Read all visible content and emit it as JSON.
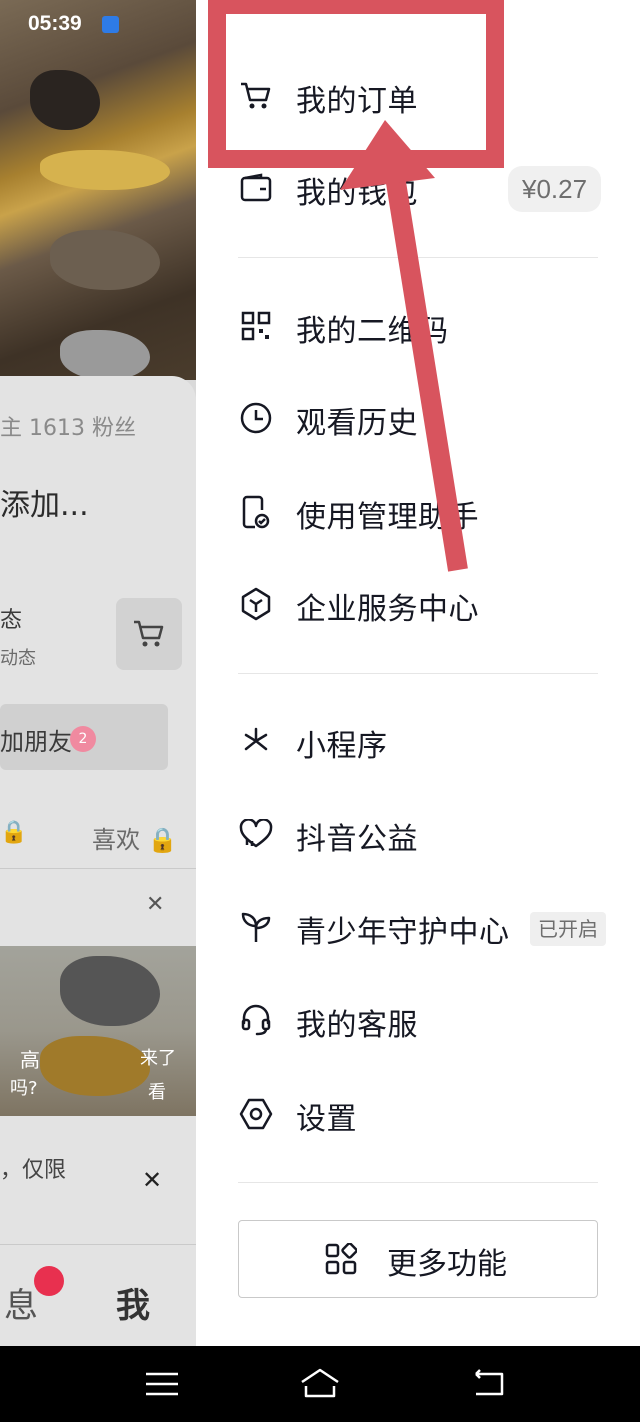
{
  "status_bar": {
    "time": "05:39"
  },
  "background": {
    "fans_text": "主  1613 粉丝",
    "add_text": "添加...",
    "state_title": "态",
    "state_subtitle": "动态",
    "friend_text": "加朋友",
    "friend_badge": "2",
    "lock_text": "🔒",
    "like_text": "喜欢 🔒",
    "video_text_1": "高",
    "video_text_2": "吗?",
    "video_text_3": "来了",
    "video_text_4": "看",
    "limited_text": "，仅限",
    "tab_message": "息",
    "tab_me": "我"
  },
  "drawer": {
    "group1": [
      {
        "label": "我的订单",
        "icon": "cart-icon"
      },
      {
        "label": "我的钱包",
        "icon": "wallet-icon",
        "badge": "¥0.27"
      }
    ],
    "group2": [
      {
        "label": "我的二维码",
        "icon": "qrcode-icon"
      },
      {
        "label": "观看历史",
        "icon": "clock-icon"
      },
      {
        "label": "使用管理助手",
        "icon": "phone-check-icon"
      },
      {
        "label": "企业服务中心",
        "icon": "enterprise-icon"
      }
    ],
    "group3": [
      {
        "label": "小程序",
        "icon": "miniprogram-icon"
      },
      {
        "label": "抖音公益",
        "icon": "heart-icon"
      },
      {
        "label": "青少年守护中心",
        "icon": "sprout-icon",
        "badge": "已开启"
      },
      {
        "label": "我的客服",
        "icon": "headset-icon"
      },
      {
        "label": "设置",
        "icon": "settings-icon"
      }
    ],
    "more_button": {
      "label": "更多功能",
      "icon": "grid-icon"
    }
  },
  "colors": {
    "annotation": "#d8545e",
    "text": "#161823",
    "badge_bg": "#f0f0f0"
  }
}
